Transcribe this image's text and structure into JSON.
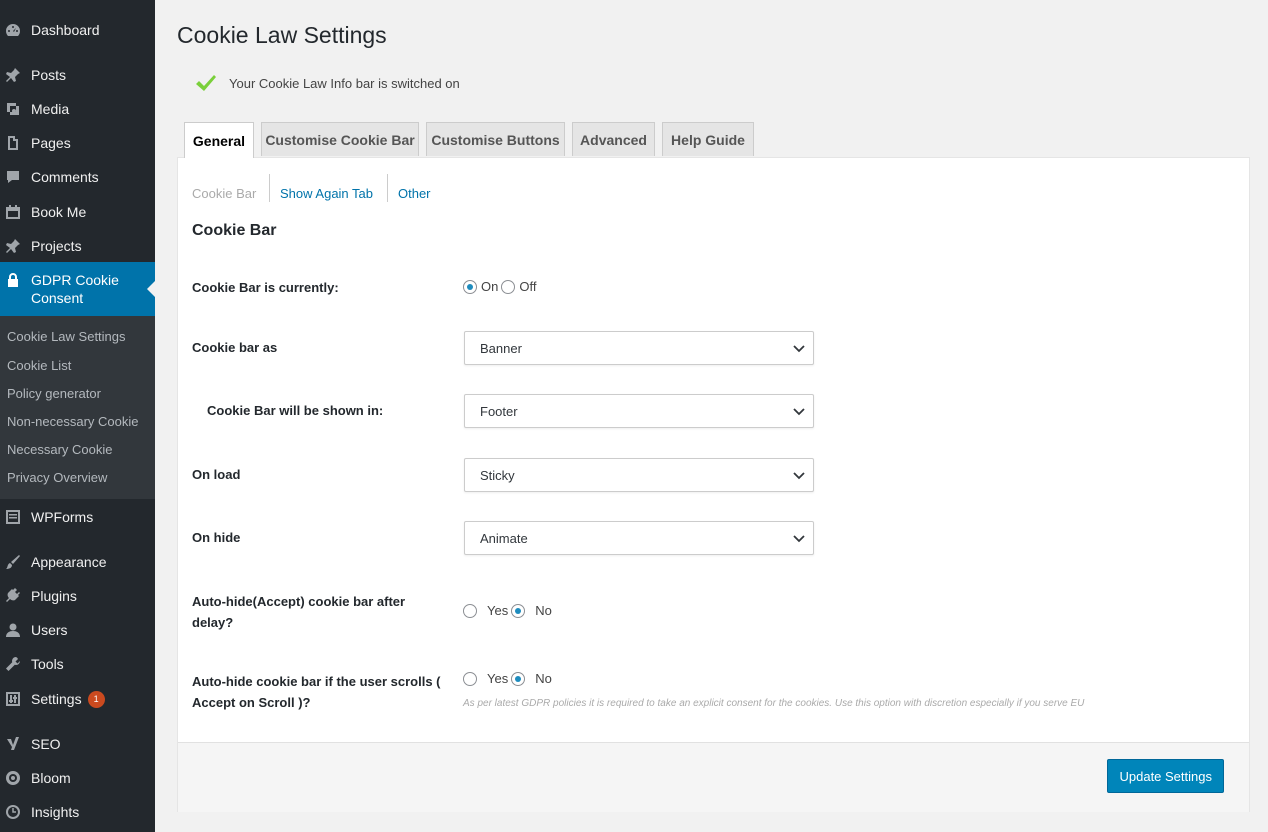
{
  "sidebar": {
    "items": [
      {
        "label": "Dashboard",
        "icon": "dashboard-icon"
      },
      {
        "label": "Posts",
        "icon": "pin-icon"
      },
      {
        "label": "Media",
        "icon": "media-icon"
      },
      {
        "label": "Pages",
        "icon": "pages-icon"
      },
      {
        "label": "Comments",
        "icon": "comment-icon"
      },
      {
        "label": "Book Me",
        "icon": "calendar-icon"
      },
      {
        "label": "Projects",
        "icon": "pin-icon"
      },
      {
        "label": "GDPR Cookie Consent",
        "icon": "lock-icon"
      },
      {
        "label": "WPForms",
        "icon": "forms-icon"
      },
      {
        "label": "Appearance",
        "icon": "brush-icon"
      },
      {
        "label": "Plugins",
        "icon": "plugin-icon"
      },
      {
        "label": "Users",
        "icon": "user-icon"
      },
      {
        "label": "Tools",
        "icon": "wrench-icon"
      },
      {
        "label": "Settings",
        "icon": "settings-icon",
        "badge": "1"
      },
      {
        "label": "SEO",
        "icon": "yoast-icon"
      },
      {
        "label": "Bloom",
        "icon": "bloom-icon"
      },
      {
        "label": "Insights",
        "icon": "insights-icon"
      }
    ],
    "submenu": [
      "Cookie Law Settings",
      "Cookie List",
      "Policy generator",
      "Non-necessary Cookie",
      "Necessary Cookie",
      "Privacy Overview"
    ]
  },
  "page": {
    "title": "Cookie Law Settings",
    "notice": "Your Cookie Law Info bar is switched on"
  },
  "tabs": [
    "General",
    "Customise Cookie Bar",
    "Customise Buttons",
    "Advanced",
    "Help Guide"
  ],
  "subtabs": [
    "Cookie Bar",
    "Show Again Tab",
    "Other"
  ],
  "section_title": "Cookie Bar",
  "fields": {
    "status": {
      "label": "Cookie Bar is currently:",
      "on": "On",
      "off": "Off",
      "selected": "On"
    },
    "bar_as": {
      "label": "Cookie bar as",
      "value": "Banner"
    },
    "shown_in": {
      "label": "Cookie Bar will be shown in:",
      "value": "Footer"
    },
    "on_load": {
      "label": "On load",
      "value": "Sticky"
    },
    "on_hide": {
      "label": "On hide",
      "value": "Animate"
    },
    "auto_hide_delay": {
      "label": "Auto-hide(Accept) cookie bar after delay?",
      "yes": "Yes",
      "no": "No",
      "selected": "No"
    },
    "auto_hide_scroll": {
      "label": "Auto-hide cookie bar if the user scrolls ( Accept on Scroll )?",
      "yes": "Yes",
      "no": "No",
      "selected": "No"
    },
    "hint": "As per latest GDPR policies it is required to take an explicit consent for the cookies. Use this option with discretion especially if you serve EU"
  },
  "buttons": {
    "update": "Update Settings"
  },
  "colors": {
    "sidebar_bg": "#23282d",
    "accent": "#0073aa",
    "button": "#0085ba",
    "badge": "#ca4a1f",
    "check": "#7ad03a"
  }
}
